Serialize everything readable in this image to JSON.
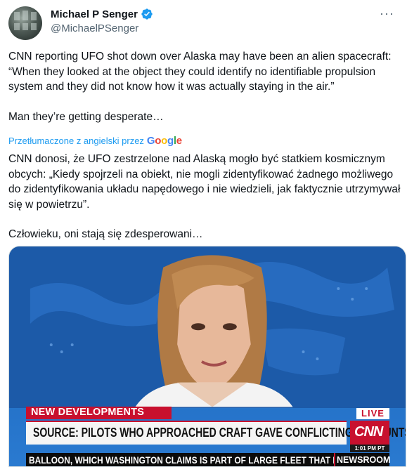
{
  "author": {
    "name": "Michael P Senger",
    "handle": "@MichaelPSenger",
    "verified": true,
    "avatar_icon": "avatar-photo"
  },
  "more_icon": "more-dots-icon",
  "tweet": {
    "text_p1": "CNN reporting UFO shot down over Alaska may have been an alien spacecraft: “When they looked at the object they could identify no identifiable propulsion system and they did not know how it was actually staying in the air.”",
    "text_p2": "Man they’re getting desperate…"
  },
  "translation": {
    "label": "Przetłumaczone z angielski przez",
    "provider": "Google",
    "text_p1": "CNN donosi, że UFO zestrzelone nad Alaską mogło być statkiem kosmicznym obcych: „Kiedy spojrzeli na obiekt, nie mogli zidentyfikować żadnego możliwego do zidentyfikowania układu napędowego i nie wiedzieli, jak faktycznie utrzymywał się w powietrzu”.",
    "text_p2": "Człowieku, oni stają się zdesperowani…"
  },
  "media": {
    "lower_third_tag": "NEW DEVELOPMENTS",
    "live_label": "LIVE",
    "headline": "SOURCE: PILOTS WHO APPROACHED CRAFT GAVE CONFLICTING ACCOUNTS",
    "network_logo": "CNN",
    "time": "1:01 PM PT",
    "ticker": "BALLOON, WHICH WASHINGTON CLAIMS IS PART OF LARGE FLEET THAT IS C",
    "program": "NEWSROOM"
  },
  "colors": {
    "link_blue": "#1d9bf0",
    "verified_blue": "#1d9bf0",
    "cnn_red": "#c8102e",
    "secondary_text": "#536471"
  }
}
